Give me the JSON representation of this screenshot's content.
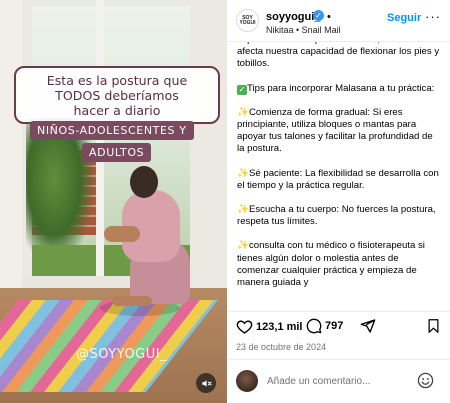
{
  "media": {
    "overlay_title": "Esta es la postura que\nTODOS deberíamos\nhacer a diario",
    "tag_line1": "NIÑOS-ADOLESCENTES Y",
    "tag_line2": "ADULTOS",
    "watermark": "@SOYYOGUI_",
    "mute_icon": "speaker-muted-icon"
  },
  "header": {
    "username": "soyyogui_",
    "verified_icon": "verified-badge-icon",
    "dot": "•",
    "subline": "Nikitaa • Snail Mail",
    "follow_label": "Seguir",
    "more_label": "···",
    "avatar_text": "SOY\nYOGUI"
  },
  "caption": {
    "p1": "especialmente el que tiene tacón, también afecta nuestra capacidad de flexionar los pies y tobillos.",
    "p2": "Tips para  incorporar Malasana a tu práctica:",
    "p3": "Comienza de forma gradual: Si eres principiante, utiliza bloques o mantas para apoyar tus talones y facilitar la profundidad de la postura.",
    "p4": "Sé paciente: La flexibilidad se desarrolla con el tiempo y la práctica regular.",
    "p5": "Escucha a tu cuerpo: No fuerces la postura, respeta tus límites.",
    "p6": "consulta con tu médico o fisioterapeuta si tienes algún dolor o molestia antes de comenzar cualquier práctica y empieza de manera guiada y"
  },
  "actions": {
    "likes": "123,1 mil",
    "comments": "797",
    "date": "23 de octubre de 2024"
  },
  "comment": {
    "placeholder": "Añade un comentario..."
  },
  "colors": {
    "accent": "#0095f6",
    "overlay_border": "#6a3b4c",
    "tag_bg": "#7c4a5f"
  }
}
